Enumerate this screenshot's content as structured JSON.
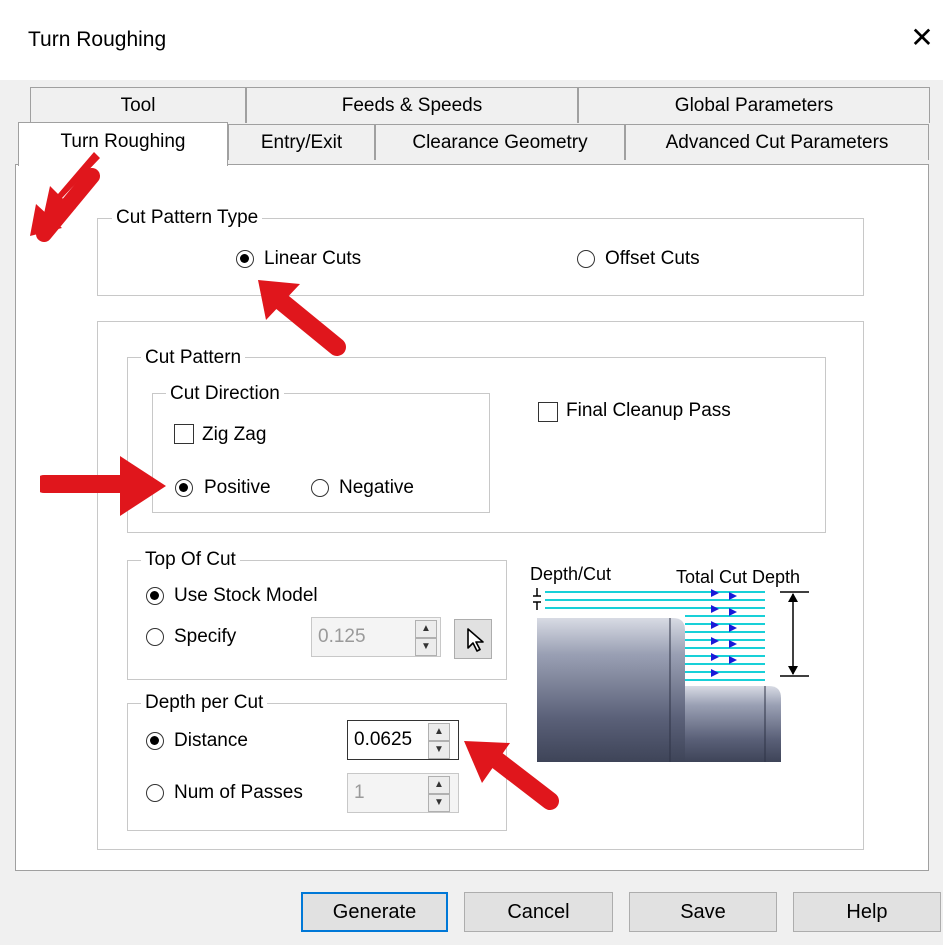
{
  "window": {
    "title": "Turn Roughing",
    "close_symbol": "✕"
  },
  "tabs_row1": [
    "Tool",
    "Feeds & Speeds",
    "Global Parameters"
  ],
  "tabs_row2": [
    "Turn Roughing",
    "Entry/Exit",
    "Clearance Geometry",
    "Advanced Cut Parameters"
  ],
  "cut_pattern_type": {
    "legend": "Cut Pattern Type",
    "linear": "Linear Cuts",
    "offset": "Offset Cuts",
    "selected": "Linear Cuts"
  },
  "cut_pattern": {
    "legend": "Cut Pattern",
    "final_cleanup": "Final Cleanup Pass",
    "final_cleanup_checked": false
  },
  "cut_direction": {
    "legend": "Cut Direction",
    "zigzag": "Zig Zag",
    "zigzag_checked": false,
    "positive": "Positive",
    "negative": "Negative",
    "selected": "Positive"
  },
  "top_of_cut": {
    "legend": "Top Of Cut",
    "use_stock": "Use Stock Model",
    "specify": "Specify",
    "specify_value": "0.125",
    "selected": "Use Stock Model"
  },
  "depth_per_cut": {
    "legend": "Depth per Cut",
    "distance": "Distance",
    "distance_value": "0.0625",
    "num_passes": "Num of Passes",
    "num_passes_value": "1",
    "selected": "Distance"
  },
  "illustration": {
    "depth_label": "Depth/Cut",
    "total_label": "Total Cut Depth"
  },
  "buttons": {
    "generate": "Generate",
    "cancel": "Cancel",
    "save": "Save",
    "help": "Help"
  },
  "colors": {
    "annotation_arrow": "#e0161c",
    "cut_lines": "#18d0d8",
    "cut_arrows": "#1a1ad8",
    "focus_border": "#0078d7"
  }
}
